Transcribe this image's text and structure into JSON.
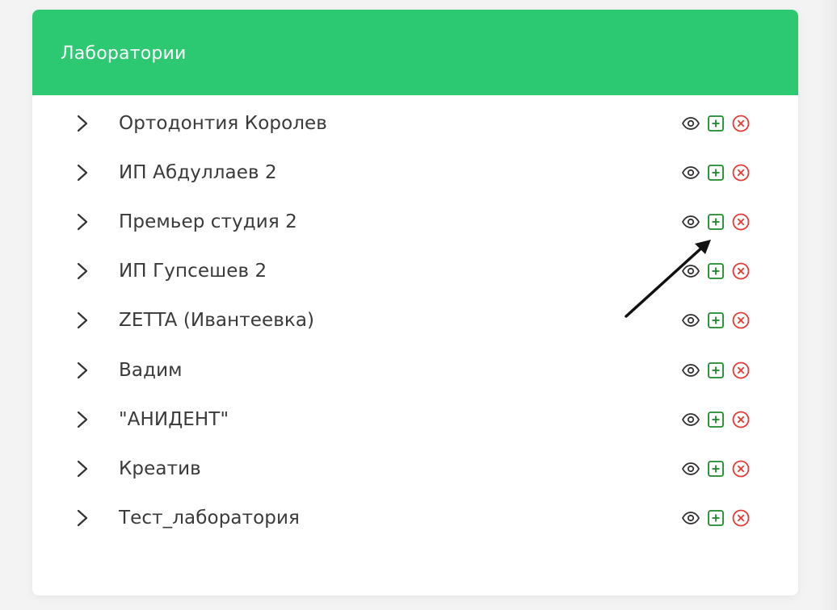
{
  "panel": {
    "title": "Лаборатории"
  },
  "laboratories": [
    {
      "name": "Ортодонтия Королев"
    },
    {
      "name": "ИП Абдуллаев 2"
    },
    {
      "name": "Премьер студия 2"
    },
    {
      "name": "ИП Гупсешев 2"
    },
    {
      "name": "ZETTA (Ивантеевка)"
    },
    {
      "name": "Вадим"
    },
    {
      "name": "\"АНИДЕНТ\""
    },
    {
      "name": "Креатив"
    },
    {
      "name": "Тест_лаборатория"
    }
  ],
  "row_actions": [
    {
      "icon": "eye-icon",
      "color": "#333333"
    },
    {
      "icon": "plus-square-icon",
      "color": "#1a8a2a"
    },
    {
      "icon": "close-circle-icon",
      "color": "#e53935"
    }
  ],
  "colors": {
    "header": "#2cc872",
    "text": "#3a3a3a"
  }
}
